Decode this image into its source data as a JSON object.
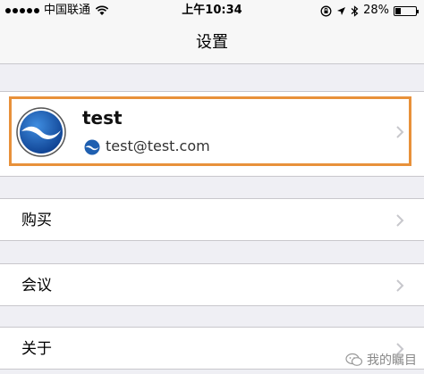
{
  "status_bar": {
    "carrier": "中国联通",
    "time": "上午10:34",
    "battery": "28%",
    "battery_level": 0.28
  },
  "nav": {
    "title": "设置"
  },
  "profile": {
    "name": "test",
    "email": "test@test.com"
  },
  "menu": {
    "purchase": "购买",
    "meeting": "会议",
    "about": "关于"
  },
  "watermark": {
    "text": "我的瞩目"
  },
  "colors": {
    "highlight": "#e8913a",
    "brand_blue": "#1f5fb0"
  }
}
